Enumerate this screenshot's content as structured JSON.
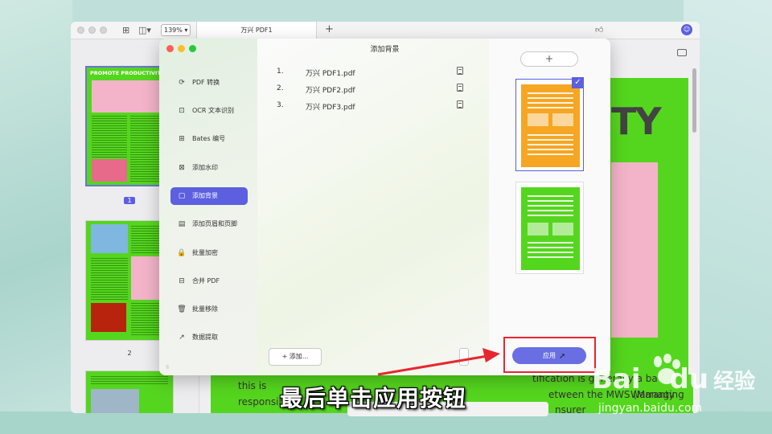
{
  "app": {
    "zoom": "139%",
    "tab_title": "万兴 PDF1",
    "tab_plus": "+",
    "user_initial": "☺"
  },
  "thumbnails": {
    "thumb1_heading": "PROMOTE PRODUCTIVITY",
    "page1": "1",
    "page2": "2"
  },
  "main_view": {
    "big_heading_fragment": "TY",
    "doc_line1_left": "this is",
    "doc_line1_right": "tification is generally a ba",
    "doc_line2_left": "responsib",
    "doc_line2_right": "etween the MWS (Managing",
    "doc_line2_tail": "Warranty",
    "doc_line3_right": "nsurer"
  },
  "dialog": {
    "title": "添加背景",
    "menu": [
      {
        "icon": "⟳",
        "label": "PDF 转换"
      },
      {
        "icon": "⊡",
        "label": "OCR 文本识别"
      },
      {
        "icon": "⊞",
        "label": "Bates 编号"
      },
      {
        "icon": "⊠",
        "label": "添加水印"
      },
      {
        "icon": "▢",
        "label": "添加背景"
      },
      {
        "icon": "▤",
        "label": "添加页眉和页脚"
      },
      {
        "icon": "🔒",
        "label": "批量加密"
      },
      {
        "icon": "⊟",
        "label": "合并 PDF"
      },
      {
        "icon": "🗑",
        "label": "批量移除"
      },
      {
        "icon": "↗",
        "label": "数据提取"
      }
    ],
    "active_menu": "添加背景",
    "files": [
      {
        "index": "1.",
        "name": "万兴 PDF1.pdf"
      },
      {
        "index": "2.",
        "name": "万兴 PDF2.pdf"
      },
      {
        "index": "3.",
        "name": "万兴 PDF3.pdf"
      }
    ],
    "add_button": "+  添加...",
    "template_add": "+",
    "apply_button": "应用",
    "check_mark": "✓"
  },
  "colors": {
    "accent": "#5b5fe0",
    "template_orange": "#f6a623",
    "template_green": "#55d61e",
    "highlight_red": "#e8262f"
  },
  "overlay": {
    "caption": "最后单击应用按钮",
    "watermark_logo_text": "Bai",
    "watermark_logo_text2": "du",
    "watermark_cn": "经验",
    "watermark_url": "jingyan.baidu.com"
  }
}
